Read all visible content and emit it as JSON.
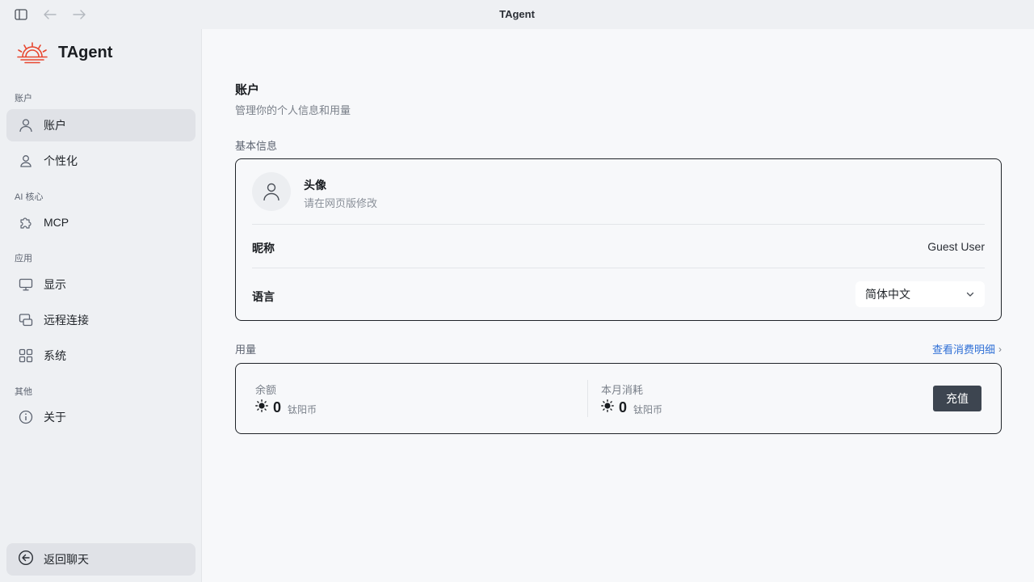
{
  "window": {
    "title": "TAgent"
  },
  "brand": {
    "name": "TAgent",
    "logo_color": "#e8462f"
  },
  "sidebar": {
    "sections": [
      {
        "label": "账户"
      },
      {
        "label": "AI 核心"
      },
      {
        "label": "应用"
      },
      {
        "label": "其他"
      }
    ],
    "items": [
      {
        "label": "账户",
        "icon": "user-icon",
        "active": true
      },
      {
        "label": "个性化",
        "icon": "user-icon"
      },
      {
        "label": "MCP",
        "icon": "puzzle-icon"
      },
      {
        "label": "显示",
        "icon": "monitor-icon"
      },
      {
        "label": "远程连接",
        "icon": "remote-icon"
      },
      {
        "label": "系统",
        "icon": "grid-icon"
      },
      {
        "label": "关于",
        "icon": "info-icon"
      }
    ],
    "back_label": "返回聊天"
  },
  "page": {
    "title": "账户",
    "subtitle": "管理你的个人信息和用量"
  },
  "basic": {
    "label": "基本信息",
    "avatar_title": "头像",
    "avatar_sub": "请在网页版修改",
    "nickname_label": "昵称",
    "nickname_value": "Guest User",
    "language_label": "语言",
    "language_value": "简体中文"
  },
  "usage": {
    "label": "用量",
    "detail_link": "查看消费明细",
    "balance_label": "余额",
    "balance_value": "0",
    "month_label": "本月消耗",
    "month_value": "0",
    "unit": "钛阳币",
    "recharge_label": "充值"
  },
  "colors": {
    "accent_link": "#2f6fd6",
    "button_dark": "#3d4550"
  }
}
